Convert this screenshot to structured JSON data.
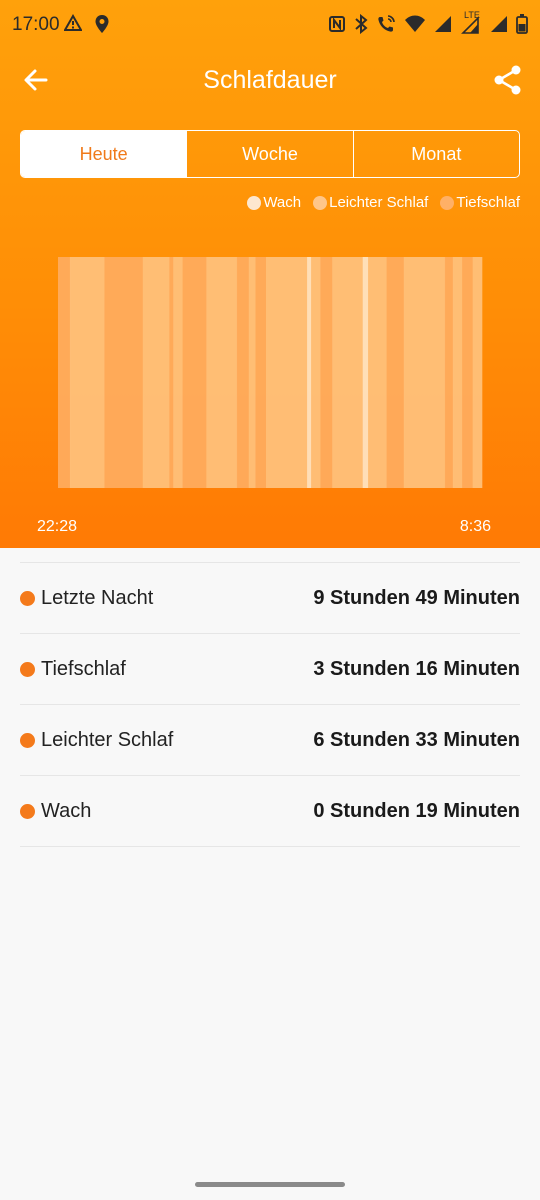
{
  "status": {
    "time": "17:00",
    "left_icons": [
      "warning-icon",
      "location-icon"
    ],
    "right_icons": [
      "nfc-icon",
      "bluetooth-icon",
      "wifi-calling-icon",
      "wifi-icon",
      "signal-icon",
      "signal-lte-icon",
      "battery-icon"
    ],
    "lte": "LTE"
  },
  "appbar": {
    "title": "Schlafdauer",
    "back_icon": "arrow-left-icon",
    "share_icon": "share-icon"
  },
  "tabs": [
    {
      "label": "Heute",
      "active": true
    },
    {
      "label": "Woche",
      "active": false
    },
    {
      "label": "Monat",
      "active": false
    }
  ],
  "legend": [
    {
      "label": "Wach",
      "color": "#fde7cf"
    },
    {
      "label": "Leichter Schlaf",
      "color": "#ffc689"
    },
    {
      "label": "Tiefschlaf",
      "color": "#ffb066"
    }
  ],
  "chart_data": {
    "type": "bar",
    "x_start_label": "22:28",
    "x_end_label": "8:36",
    "stages_legend": [
      "Wach",
      "Leichter Schlaf",
      "Tiefschlaf"
    ],
    "colors": {
      "Wach": "#ffe6c7",
      "Leichter Schlaf": "#ffc27e",
      "Tiefschlaf": "#ffad5f"
    },
    "segments": [
      {
        "stage": "Tiefschlaf",
        "minutes": 9
      },
      {
        "stage": "Leichter Schlaf",
        "minutes": 26
      },
      {
        "stage": "Tiefschlaf",
        "minutes": 29
      },
      {
        "stage": "Leichter Schlaf",
        "minutes": 20
      },
      {
        "stage": "Tiefschlaf",
        "minutes": 3
      },
      {
        "stage": "Leichter Schlaf",
        "minutes": 7
      },
      {
        "stage": "Tiefschlaf",
        "minutes": 18
      },
      {
        "stage": "Leichter Schlaf",
        "minutes": 23
      },
      {
        "stage": "Tiefschlaf",
        "minutes": 9
      },
      {
        "stage": "Leichter Schlaf",
        "minutes": 5
      },
      {
        "stage": "Tiefschlaf",
        "minutes": 8
      },
      {
        "stage": "Leichter Schlaf",
        "minutes": 31
      },
      {
        "stage": "Wach",
        "minutes": 3
      },
      {
        "stage": "Leichter Schlaf",
        "minutes": 7
      },
      {
        "stage": "Tiefschlaf",
        "minutes": 9
      },
      {
        "stage": "Leichter Schlaf",
        "minutes": 23
      },
      {
        "stage": "Wach",
        "minutes": 4
      },
      {
        "stage": "Leichter Schlaf",
        "minutes": 14
      },
      {
        "stage": "Tiefschlaf",
        "minutes": 13
      },
      {
        "stage": "Leichter Schlaf",
        "minutes": 31
      },
      {
        "stage": "Tiefschlaf",
        "minutes": 6
      },
      {
        "stage": "Leichter Schlaf",
        "minutes": 7
      },
      {
        "stage": "Tiefschlaf",
        "minutes": 8
      },
      {
        "stage": "Leichter Schlaf",
        "minutes": 7
      }
    ]
  },
  "summary": [
    {
      "label": "Letzte Nacht",
      "value": "9 Stunden 49 Minuten"
    },
    {
      "label": "Tiefschlaf",
      "value": "3 Stunden 16 Minuten"
    },
    {
      "label": "Leichter Schlaf",
      "value": "6 Stunden 33 Minuten"
    },
    {
      "label": "Wach",
      "value": "0 Stunden 19 Minuten"
    }
  ]
}
